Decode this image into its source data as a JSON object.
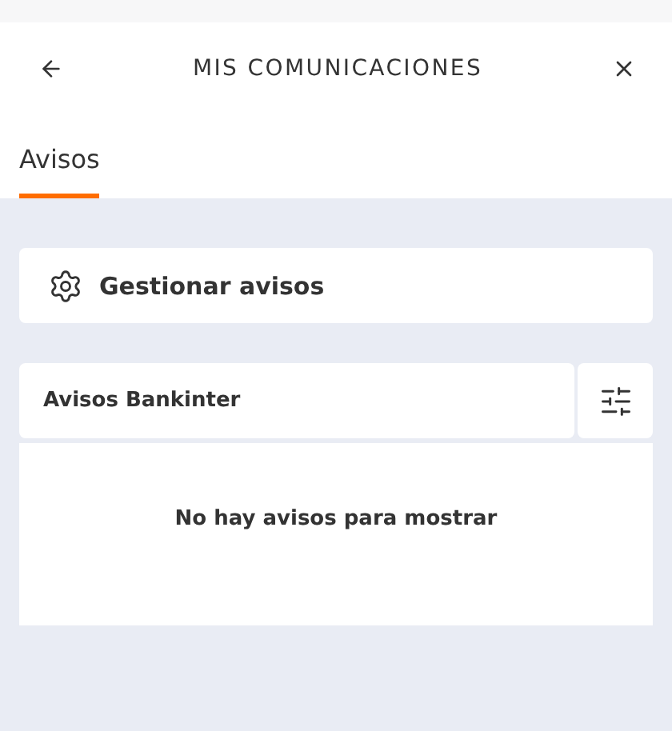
{
  "header": {
    "title": "MIS COMUNICACIONES"
  },
  "tabs": [
    {
      "label": "Avisos",
      "selected": true
    }
  ],
  "manage": {
    "label": "Gestionar avisos"
  },
  "notices": {
    "title": "Avisos Bankinter",
    "empty_message": "No hay avisos para mostrar"
  }
}
